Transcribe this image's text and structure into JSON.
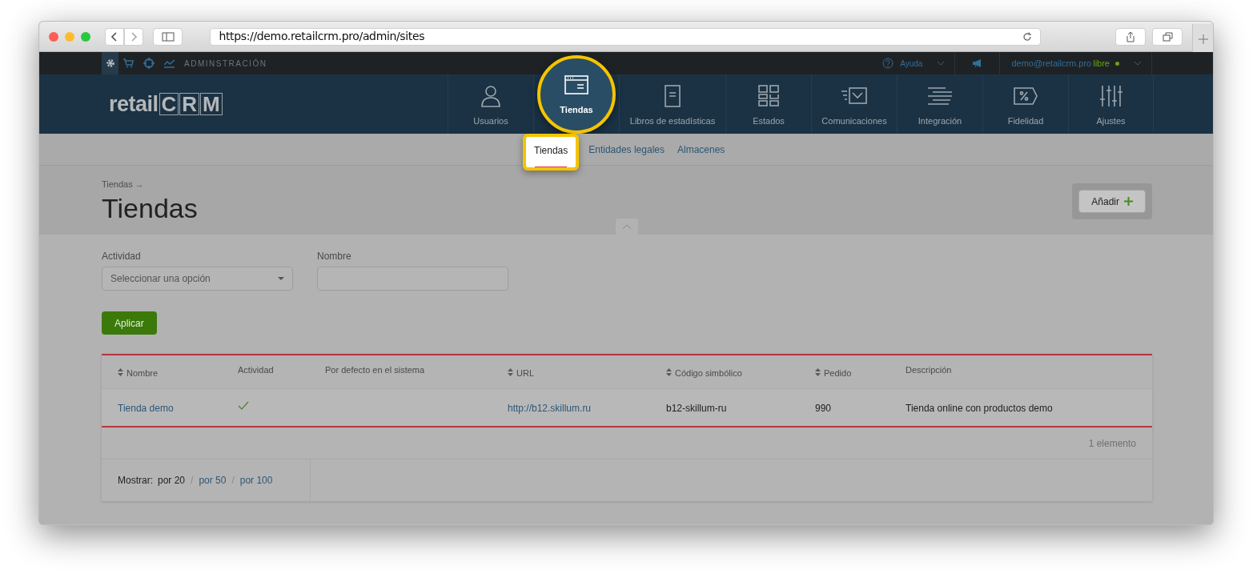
{
  "browser": {
    "url": "https://demo.retailcrm.pro/admin/sites"
  },
  "top_bar": {
    "section": "ADMINSTRACIÓN",
    "help": "Ayuda",
    "user": "demo@retailcrm.pro",
    "plan": "libre"
  },
  "logo": {
    "prefix": "retail",
    "letters": [
      "C",
      "R",
      "M"
    ]
  },
  "nav": [
    {
      "label": "Usuarios",
      "selected": false
    },
    {
      "label": "Tiendas",
      "selected": true
    },
    {
      "label": "Libros de estadísticas",
      "selected": false
    },
    {
      "label": "Estados",
      "selected": false
    },
    {
      "label": "Comunicaciones",
      "selected": false
    },
    {
      "label": "Integración",
      "selected": false
    },
    {
      "label": "Fidelidad",
      "selected": false
    },
    {
      "label": "Ajustes",
      "selected": false
    }
  ],
  "subnav": [
    {
      "label": "Tiendas",
      "selected": true
    },
    {
      "label": "Entidades legales",
      "selected": false
    },
    {
      "label": "Almacenes",
      "selected": false
    }
  ],
  "breadcrumb": "Tiendas →",
  "title": "Tiendas",
  "add_button": "Añadir",
  "filters": [
    {
      "kind": "select",
      "label": "Actividad",
      "placeholder": "Seleccionar una opción"
    },
    {
      "kind": "text",
      "label": "Nombre"
    }
  ],
  "apply_button": "Aplicar",
  "table": {
    "columns": [
      {
        "label": "Nombre",
        "sortable": true
      },
      {
        "label": "Actividad",
        "sortable": false
      },
      {
        "label": "Por defecto en el sistema",
        "sortable": false
      },
      {
        "label": "URL",
        "sortable": true
      },
      {
        "label": "Código simbólico",
        "sortable": true
      },
      {
        "label": "Pedido",
        "sortable": true
      },
      {
        "label": "Descripción",
        "sortable": false
      }
    ],
    "rows": [
      {
        "name": "Tienda demo",
        "active": true,
        "url": "http://b12.skillum.ru",
        "code": "b12-skillum-ru",
        "order": "990",
        "description": "Tienda online con productos demo"
      }
    ],
    "count": "1 elemento"
  },
  "pagination": {
    "label": "Mostrar:",
    "separator": "/",
    "options": [
      {
        "label": "por 20",
        "selected": true
      },
      {
        "label": "por 50",
        "selected": false
      },
      {
        "label": "por 100",
        "selected": false
      }
    ]
  }
}
